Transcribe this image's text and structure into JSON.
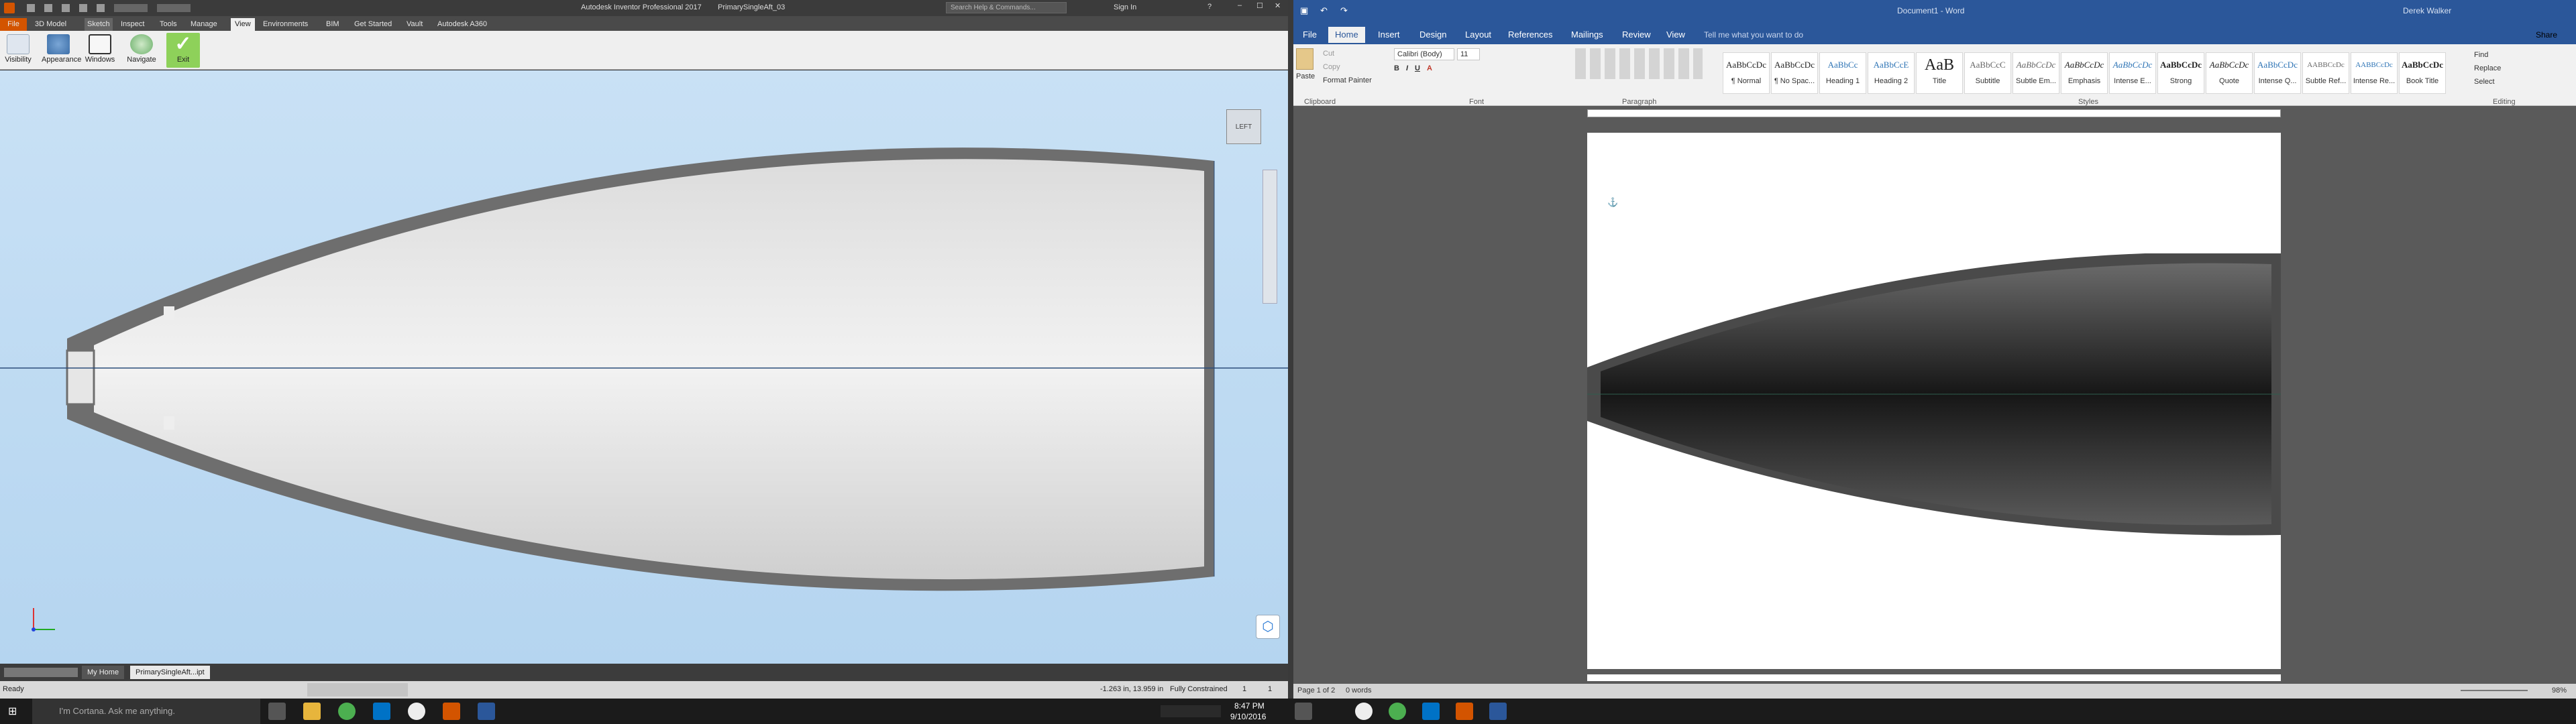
{
  "inventor": {
    "app_title": "Autodesk Inventor Professional 2017",
    "doc_title": "PrimarySingleAft_03",
    "search_placeholder": "Search Help & Commands...",
    "sign_in": "Sign In",
    "file_tab": "File",
    "tabs": [
      "3D Model",
      "Sketch",
      "Inspect",
      "Tools",
      "Manage",
      "View",
      "Environments",
      "BIM",
      "Get Started",
      "Vault",
      "Autodesk A360"
    ],
    "active_tab": "View",
    "ribbon_buttons": [
      "Visibility",
      "Appearance",
      "Windows",
      "Navigate",
      "Exit"
    ],
    "viewcube_label": "LEFT",
    "status_left": "Ready",
    "status_right": "-1.263 in, 13.959 in",
    "constraint_status": "Fully Constrained",
    "count_a": "1",
    "count_b": "1",
    "doc_tabs": [
      "My Home",
      "PrimarySingleAft...ipt"
    ]
  },
  "word": {
    "title": "Document1 - Word",
    "user": "Derek Walker",
    "tabs": [
      "File",
      "Home",
      "Insert",
      "Design",
      "Layout",
      "References",
      "Mailings",
      "Review",
      "View"
    ],
    "active_tab": "Home",
    "tell_me": "Tell me what you want to do",
    "share": "Share",
    "clipboard": {
      "cut": "Cut",
      "copy": "Copy",
      "format_painter": "Format Painter",
      "paste": "Paste"
    },
    "font": {
      "name": "Calibri (Body)",
      "size": "11"
    },
    "styles": [
      {
        "sample": "AaBbCcDc",
        "name": "¶ Normal"
      },
      {
        "sample": "AaBbCcDc",
        "name": "¶ No Spac..."
      },
      {
        "sample": "AaBbCc",
        "name": "Heading 1"
      },
      {
        "sample": "AaBbCcE",
        "name": "Heading 2"
      },
      {
        "sample": "AaB",
        "name": "Title"
      },
      {
        "sample": "AaBbCcC",
        "name": "Subtitle"
      },
      {
        "sample": "AaBbCcDc",
        "name": "Subtle Em..."
      },
      {
        "sample": "AaBbCcDc",
        "name": "Emphasis"
      },
      {
        "sample": "AaBbCcDc",
        "name": "Intense E..."
      },
      {
        "sample": "AaBbCcDc",
        "name": "Strong"
      },
      {
        "sample": "AaBbCcDc",
        "name": "Quote"
      },
      {
        "sample": "AaBbCcDc",
        "name": "Intense Q..."
      },
      {
        "sample": "AABBCcDc",
        "name": "Subtle Ref..."
      },
      {
        "sample": "AABBCcDc",
        "name": "Intense Re..."
      },
      {
        "sample": "AaBbCcDc",
        "name": "Book Title"
      }
    ],
    "editing": {
      "find": "Find",
      "replace": "Replace",
      "select": "Select"
    },
    "group_labels": [
      "Clipboard",
      "Font",
      "Paragraph",
      "Styles",
      "Editing"
    ],
    "status_page": "Page 1 of 2",
    "status_words": "0 words",
    "zoom": "98%"
  },
  "taskbar": {
    "cortana": "I'm Cortana. Ask me anything.",
    "time": "8:47 PM",
    "date": "9/10/2016"
  },
  "colors": {
    "inventor_accent": "#d35400",
    "word_accent": "#2b579a",
    "exit_green": "#7bc043"
  }
}
